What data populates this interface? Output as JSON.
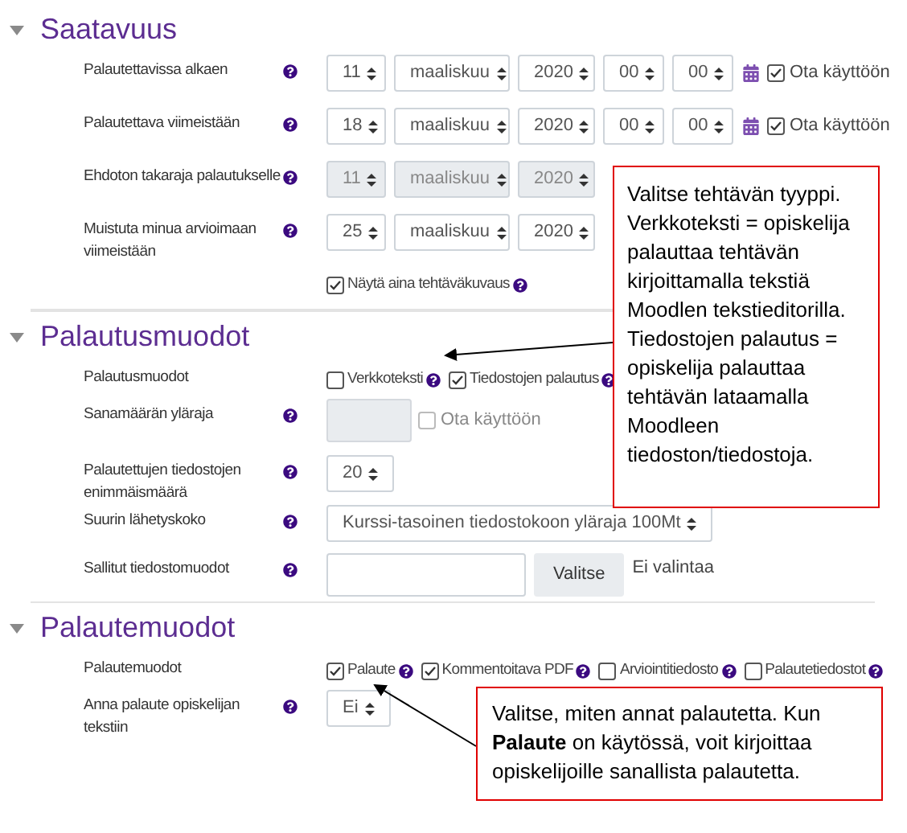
{
  "sections": [
    {
      "title": "Saatavuus",
      "expanded": true,
      "rows": [
        {
          "kind": "date",
          "label": "Palautettavissa alkaen",
          "help": true,
          "disabled": false,
          "selects": [
            "11",
            "maaliskuu",
            "2020",
            "00",
            "00"
          ],
          "calendar": true,
          "enable": {
            "label": "Ota käyttöön",
            "checked": true
          }
        },
        {
          "kind": "date",
          "label": "Palautettava viimeistään",
          "help": true,
          "disabled": false,
          "selects": [
            "18",
            "maaliskuu",
            "2020",
            "00",
            "00"
          ],
          "calendar": true,
          "enable": {
            "label": "Ota käyttöön",
            "checked": true
          }
        },
        {
          "kind": "date",
          "label": "Ehdoton takaraja palautukselle",
          "help": true,
          "disabled": true,
          "selects": [
            "11",
            "maaliskuu",
            "2020"
          ]
        },
        {
          "kind": "date",
          "label": "Muistuta minua arvioimaan viimeistään",
          "help": true,
          "disabled": false,
          "selects": [
            "25",
            "maaliskuu",
            "2020"
          ]
        },
        {
          "kind": "checkboxes",
          "options": [
            {
              "label": "Näytä aina tehtäväkuvaus",
              "checked": true,
              "help": true
            }
          ]
        }
      ]
    },
    {
      "title": "Palautusmuodot",
      "expanded": true,
      "rows": [
        {
          "kind": "checkboxes",
          "label": "Palautusmuodot",
          "help": false,
          "options": [
            {
              "label": "Verkkoteksti",
              "checked": false,
              "help": true
            },
            {
              "label": "Tiedostojen palautus",
              "checked": true,
              "help": true
            }
          ]
        },
        {
          "kind": "text",
          "label": "Sanamäärän yläraja",
          "help": true,
          "disabled": true,
          "enable": {
            "label": "Ota käyttöön",
            "checked": false
          }
        },
        {
          "kind": "select",
          "label": "Palautettujen tiedostojen enimmäismäärä",
          "help": true,
          "value": "20"
        },
        {
          "kind": "select",
          "label": "Suurin lähetyskoko",
          "help": true,
          "value": "Kurssi-tasoinen tiedostokoon yläraja 100Mt"
        },
        {
          "kind": "filetypes",
          "label": "Sallitut tiedostomuodot",
          "help": true,
          "button": "Valitse",
          "note": "Ei valintaa"
        }
      ]
    },
    {
      "title": "Palautemuodot",
      "expanded": true,
      "rows": [
        {
          "kind": "checkboxes",
          "label": "Palautemuodot",
          "help": false,
          "options": [
            {
              "label": "Palaute",
              "checked": true,
              "help": true
            },
            {
              "label": "Kommentoitava PDF",
              "checked": true,
              "help": true
            },
            {
              "label": "Arviointitiedosto",
              "checked": false,
              "help": true
            },
            {
              "label": "Palautetiedostot",
              "checked": false,
              "help": true
            }
          ]
        },
        {
          "kind": "select",
          "label": "Anna palaute opiskelijan tekstiin",
          "help": true,
          "value": "Ei"
        }
      ]
    }
  ],
  "callouts": [
    {
      "text": "Valitse tehtävän tyyppi. Verkkoteksti = opiskelija palauttaa tehtävän kirjoittamalla tekstiä Moodlen tekstieditorilla. Tiedostojen palautus = opiskelija palauttaa tehtävän lataamalla Moodleen tiedoston/tiedostoja."
    },
    {
      "text": "Valitse, miten annat palautetta. Kun **Palaute** on käytössä, voit kirjoittaa opiskelijoille sanallista palautetta."
    }
  ]
}
